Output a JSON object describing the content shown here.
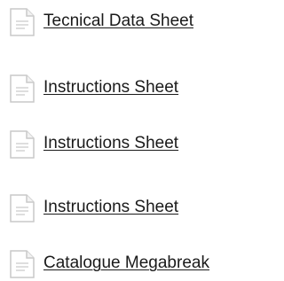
{
  "documents": [
    {
      "label": "Tecnical Data Sheet",
      "icon": "document-icon"
    },
    {
      "label": "Instructions Sheet",
      "icon": "document-icon"
    },
    {
      "label": "Instructions Sheet",
      "icon": "document-icon"
    },
    {
      "label": "Instructions Sheet",
      "icon": "document-icon"
    },
    {
      "label": "Catalogue Megabreak",
      "icon": "document-icon"
    }
  ],
  "colors": {
    "link_text": "#1a1a1a",
    "icon_stroke": "#c9c9c9",
    "icon_fill": "#ffffff",
    "icon_lines": "#d3d3d3"
  }
}
